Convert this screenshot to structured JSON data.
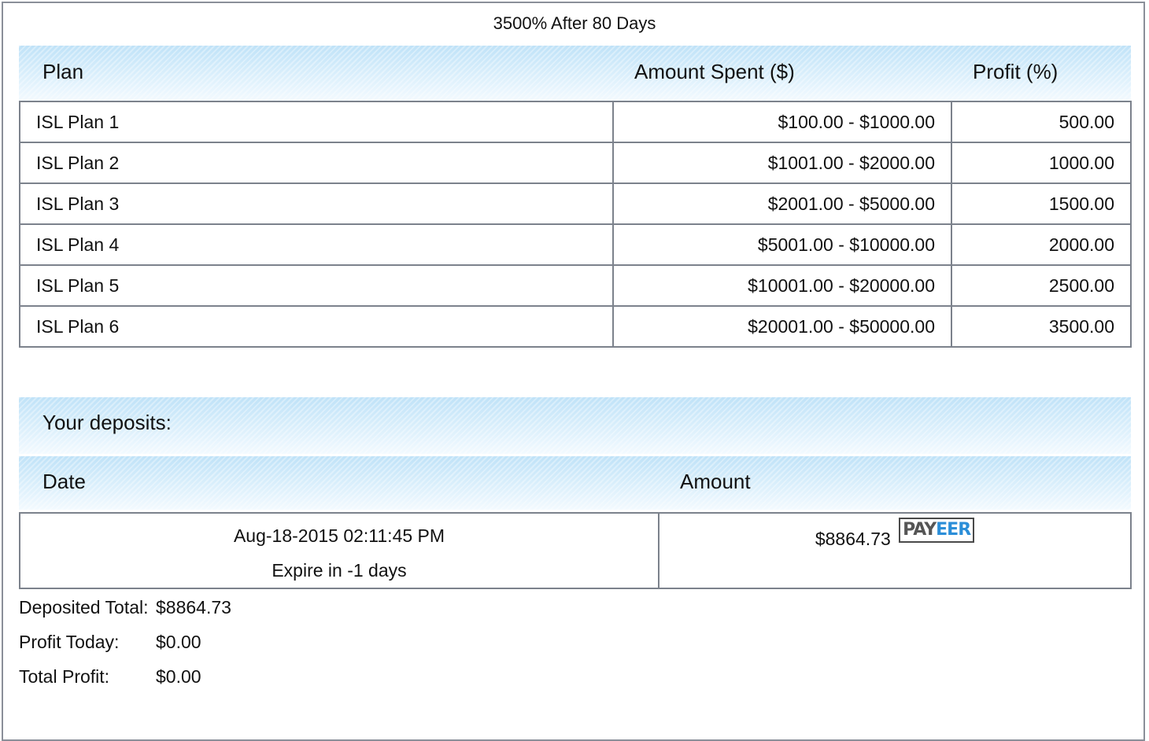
{
  "plan_title": "3500% After 80 Days",
  "plans_table": {
    "headers": {
      "plan": "Plan",
      "amount": "Amount Spent ($)",
      "profit": "Profit (%)"
    },
    "rows": [
      {
        "name": "ISL Plan 1",
        "amount": "$100.00 - $1000.00",
        "profit": "500.00"
      },
      {
        "name": "ISL Plan 2",
        "amount": "$1001.00 - $2000.00",
        "profit": "1000.00"
      },
      {
        "name": "ISL Plan 3",
        "amount": "$2001.00 - $5000.00",
        "profit": "1500.00"
      },
      {
        "name": "ISL Plan 4",
        "amount": "$5001.00 - $10000.00",
        "profit": "2000.00"
      },
      {
        "name": "ISL Plan 5",
        "amount": "$10001.00 - $20000.00",
        "profit": "2500.00"
      },
      {
        "name": "ISL Plan 6",
        "amount": "$20001.00 - $50000.00",
        "profit": "3500.00"
      }
    ]
  },
  "deposits": {
    "heading": "Your deposits:",
    "headers": {
      "date": "Date",
      "amount": "Amount"
    },
    "rows": [
      {
        "date": "Aug-18-2015 02:11:45 PM",
        "expire": "Expire in -1 days",
        "amount": "$8864.73",
        "processor_logo": {
          "part1": "PAY",
          "part2": "EER"
        }
      }
    ]
  },
  "summary": {
    "deposited_total_label": "Deposited Total:",
    "deposited_total_value": "$8864.73",
    "profit_today_label": "Profit Today:",
    "profit_today_value": "$0.00",
    "total_profit_label": "Total Profit:",
    "total_profit_value": "$0.00"
  },
  "colors": {
    "header_band": "#d4ebf9",
    "border": "#7c828c",
    "payeer_blue": "#2b8ed8"
  }
}
